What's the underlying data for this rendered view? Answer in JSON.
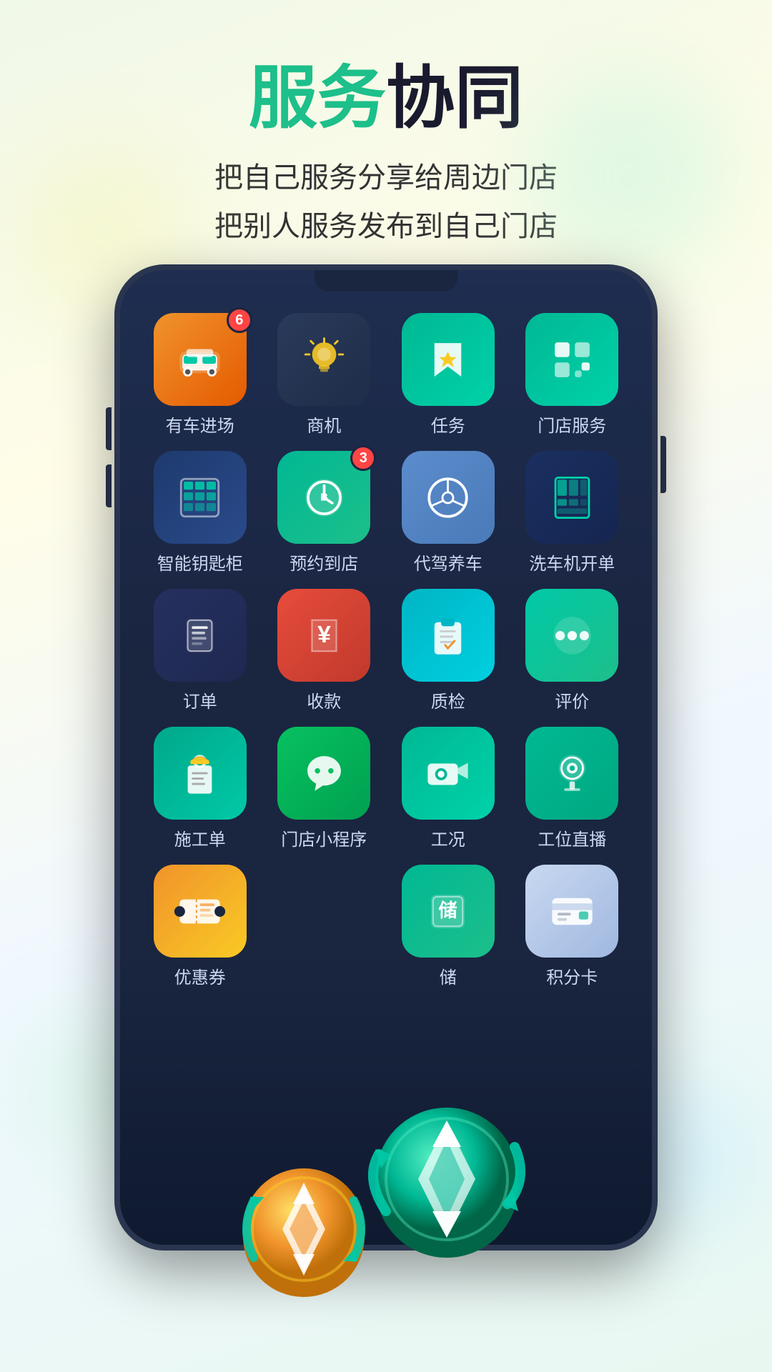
{
  "header": {
    "title_green": "服务",
    "title_dark": "协同",
    "subtitle_line1": "把自己服务分享给周边门店",
    "subtitle_line2": "把别人服务发布到自己门店"
  },
  "apps": [
    {
      "id": "car-entry",
      "label": "有车进场",
      "badge": "6",
      "bg": "orange",
      "icon": "car"
    },
    {
      "id": "opportunity",
      "label": "商机",
      "badge": "",
      "bg": "yellow-light",
      "icon": "bulb"
    },
    {
      "id": "task",
      "label": "任务",
      "badge": "",
      "bg": "teal",
      "icon": "bookmark"
    },
    {
      "id": "store-service",
      "label": "门店服务",
      "badge": "",
      "bg": "teal-tile",
      "icon": "grid"
    },
    {
      "id": "smart-key",
      "label": "智能钥匙柜",
      "badge": "",
      "bg": "dark-blue",
      "icon": "keypad"
    },
    {
      "id": "appointment",
      "label": "预约到店",
      "badge": "3",
      "bg": "teal-medium",
      "icon": "clock-b"
    },
    {
      "id": "valet",
      "label": "代驾养车",
      "badge": "",
      "bg": "gray-blue",
      "icon": "steering"
    },
    {
      "id": "washer",
      "label": "洗车机开单",
      "badge": "",
      "bg": "dark-blue2",
      "icon": "machine"
    },
    {
      "id": "order",
      "label": "订单",
      "badge": "",
      "bg": "dark-blue3",
      "icon": "list"
    },
    {
      "id": "payment",
      "label": "收款",
      "badge": "",
      "bg": "red-orange",
      "icon": "yuan"
    },
    {
      "id": "quality",
      "label": "质检",
      "badge": "",
      "bg": "teal-light2",
      "icon": "clipboard"
    },
    {
      "id": "review",
      "label": "评价",
      "badge": "",
      "bg": "green-bright",
      "icon": "dots"
    },
    {
      "id": "work-order",
      "label": "施工单",
      "badge": "",
      "bg": "teal-dark",
      "icon": "worker"
    },
    {
      "id": "mini-program",
      "label": "门店小程序",
      "badge": "",
      "bg": "green-wechat",
      "icon": "wechat"
    },
    {
      "id": "live",
      "label": "工况",
      "badge": "",
      "bg": "teal-cam",
      "icon": "camera"
    },
    {
      "id": "station-live",
      "label": "工位直播",
      "badge": "",
      "bg": "teal-eye",
      "icon": "webcam"
    },
    {
      "id": "coupon",
      "label": "优惠券",
      "badge": "",
      "bg": "yellow-coupon",
      "icon": "coupon"
    },
    {
      "id": "store-hidden",
      "label": "",
      "badge": "",
      "bg": "empty",
      "icon": "empty"
    },
    {
      "id": "storage",
      "label": "储",
      "badge": "",
      "bg": "empty2",
      "icon": "empty2"
    },
    {
      "id": "points-card",
      "label": "积分卡",
      "badge": "",
      "bg": "light-card",
      "icon": "card"
    }
  ],
  "coins": {
    "gold_label": "gold coin",
    "green_label": "green coin"
  }
}
